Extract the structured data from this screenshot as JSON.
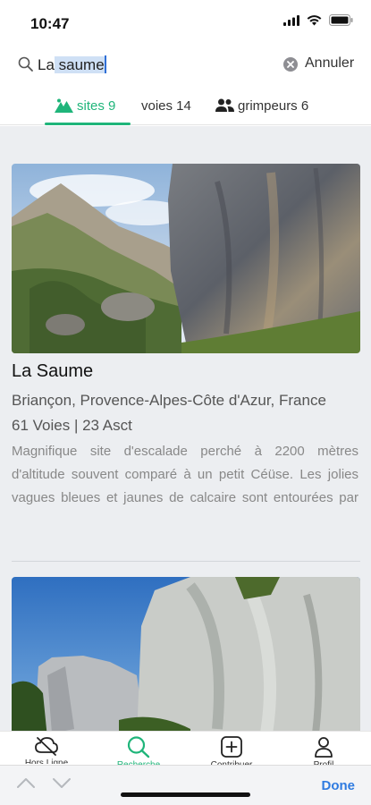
{
  "status_bar": {
    "time": "10:47"
  },
  "search": {
    "text_before": "La",
    "text_selected": " saume",
    "cancel_label": "Annuler"
  },
  "tabs": [
    {
      "label": "sites 9",
      "icon": "mountain-icon",
      "active": true
    },
    {
      "label": "voies 14",
      "icon": "none",
      "active": false
    },
    {
      "label": "grimpeurs 6",
      "icon": "people-icon",
      "active": false
    }
  ],
  "results": [
    {
      "image": "mountain-cliff-photo",
      "title": "La Saume",
      "location": "Briançon, Provence-Alpes-Côte d'Azur, France",
      "stats": "61 Voies | 23 Asct",
      "description": "Magnifique site d'escalade perché à 2200 mètres d'altitude souvent comparé à un petit Céüse. Les jolies vagues bleues et jaunes de calcaire sont entourées par un cadre exceptionnel : une v"
    },
    {
      "image": "limestone-cliff-photo"
    }
  ],
  "bottom_nav": [
    {
      "label": "Hors Ligne",
      "icon": "cloud-offline-icon"
    },
    {
      "label": "Recherche",
      "icon": "search-icon",
      "active": true
    },
    {
      "label": "Contribuer",
      "icon": "plus-square-icon"
    },
    {
      "label": "Profil",
      "icon": "user-icon"
    }
  ],
  "keyboard_bar": {
    "done_label": "Done"
  },
  "colors": {
    "accent": "#1fb57a",
    "link": "#2f7be0",
    "background": "#eceef1"
  }
}
